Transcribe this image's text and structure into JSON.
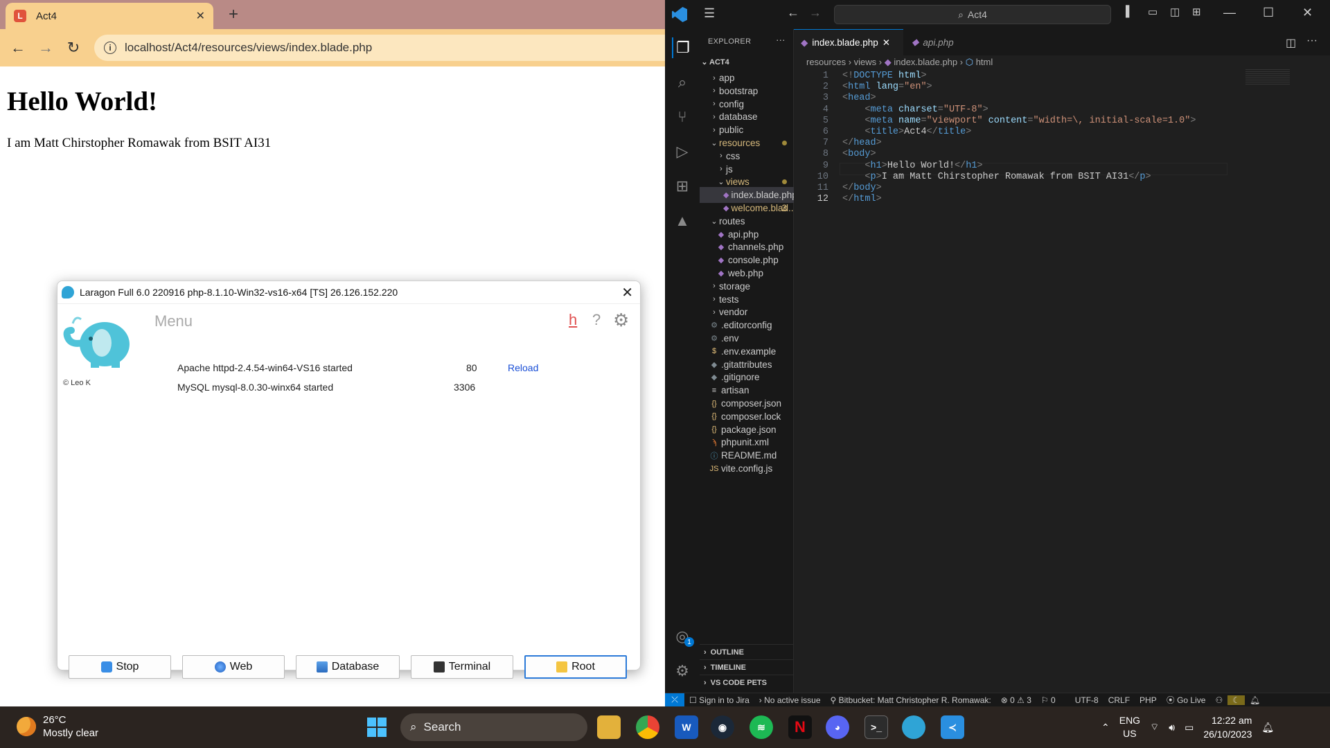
{
  "browser": {
    "tab_title": "Act4",
    "tab_close": "✕",
    "new_tab": "+",
    "url": "localhost/Act4/resources/views/index.blade.php",
    "page_heading": "Hello World!",
    "page_paragraph": "I am Matt Chirstopher Romawak from BSIT AI31"
  },
  "laragon": {
    "title": "Laragon Full 6.0 220916 php-8.1.10-Win32-vs16-x64 [TS]  26.126.152.220",
    "menu": "Menu",
    "copyright": "© Leo K",
    "h_link": "h",
    "help": "?",
    "services": [
      {
        "name": "Apache httpd-2.4.54-win64-VS16 started",
        "port": "80",
        "action": "Reload"
      },
      {
        "name": "MySQL mysql-8.0.30-winx64 started",
        "port": "3306"
      }
    ],
    "buttons": {
      "stop": "Stop",
      "web": "Web",
      "database": "Database",
      "terminal": "Terminal",
      "root": "Root"
    }
  },
  "vscode": {
    "search": "Act4",
    "explorer_label": "EXPLORER",
    "project": "ACT4",
    "tree": [
      {
        "label": "app",
        "type": "folder",
        "depth": 0
      },
      {
        "label": "bootstrap",
        "type": "folder",
        "depth": 0
      },
      {
        "label": "config",
        "type": "folder",
        "depth": 0
      },
      {
        "label": "database",
        "type": "folder",
        "depth": 0
      },
      {
        "label": "public",
        "type": "folder",
        "depth": 0
      },
      {
        "label": "resources",
        "type": "folder-open",
        "depth": 0,
        "modified": true
      },
      {
        "label": "css",
        "type": "folder",
        "depth": 1
      },
      {
        "label": "js",
        "type": "folder",
        "depth": 1
      },
      {
        "label": "views",
        "type": "folder-open",
        "depth": 1,
        "modified": true
      },
      {
        "label": "index.blade.php",
        "type": "php",
        "depth": 2,
        "selected": true
      },
      {
        "label": "welcome.blad...",
        "type": "php",
        "depth": 2,
        "modified": true,
        "badge": "3"
      },
      {
        "label": "routes",
        "type": "folder-open",
        "depth": 0
      },
      {
        "label": "api.php",
        "type": "php",
        "depth": 1
      },
      {
        "label": "channels.php",
        "type": "php",
        "depth": 1
      },
      {
        "label": "console.php",
        "type": "php",
        "depth": 1
      },
      {
        "label": "web.php",
        "type": "php",
        "depth": 1
      },
      {
        "label": "storage",
        "type": "folder",
        "depth": 0
      },
      {
        "label": "tests",
        "type": "folder",
        "depth": 0
      },
      {
        "label": "vendor",
        "type": "folder",
        "depth": 0
      },
      {
        "label": ".editorconfig",
        "type": "gear",
        "depth": 0
      },
      {
        "label": ".env",
        "type": "gear",
        "depth": 0
      },
      {
        "label": ".env.example",
        "type": "dollar",
        "depth": 0
      },
      {
        "label": ".gitattributes",
        "type": "git",
        "depth": 0
      },
      {
        "label": ".gitignore",
        "type": "git",
        "depth": 0
      },
      {
        "label": "artisan",
        "type": "lines",
        "depth": 0
      },
      {
        "label": "composer.json",
        "type": "json",
        "depth": 0
      },
      {
        "label": "composer.lock",
        "type": "json",
        "depth": 0
      },
      {
        "label": "package.json",
        "type": "json",
        "depth": 0
      },
      {
        "label": "phpunit.xml",
        "type": "rss",
        "depth": 0
      },
      {
        "label": "README.md",
        "type": "info",
        "depth": 0
      },
      {
        "label": "vite.config.js",
        "type": "js",
        "depth": 0
      }
    ],
    "tabs": [
      {
        "label": "index.blade.php",
        "active": true,
        "close": "✕"
      },
      {
        "label": "api.php",
        "active": false
      }
    ],
    "breadcrumb": [
      "resources",
      "views",
      "index.blade.php",
      "html"
    ],
    "code_lines": [
      [
        [
          "pu",
          "<!"
        ],
        [
          "tg",
          "DOCTYPE"
        ],
        [
          "pu",
          " "
        ],
        [
          "at",
          "html"
        ],
        [
          "pu",
          ">"
        ]
      ],
      [
        [
          "pu",
          "<"
        ],
        [
          "tg",
          "html"
        ],
        [
          "pu",
          " "
        ],
        [
          "at",
          "lang"
        ],
        [
          "pu",
          "="
        ],
        [
          "st",
          "\"en\""
        ],
        [
          "pu",
          ">"
        ]
      ],
      [
        [
          "pu",
          "<"
        ],
        [
          "tg",
          "head"
        ],
        [
          "pu",
          ">"
        ]
      ],
      [
        [
          "pu",
          "    <"
        ],
        [
          "tg",
          "meta"
        ],
        [
          "pu",
          " "
        ],
        [
          "at",
          "charset"
        ],
        [
          "pu",
          "="
        ],
        [
          "st",
          "\"UTF-8\""
        ],
        [
          "pu",
          ">"
        ]
      ],
      [
        [
          "pu",
          "    <"
        ],
        [
          "tg",
          "meta"
        ],
        [
          "pu",
          " "
        ],
        [
          "at",
          "name"
        ],
        [
          "pu",
          "="
        ],
        [
          "st",
          "\"viewport\""
        ],
        [
          "pu",
          " "
        ],
        [
          "at",
          "content"
        ],
        [
          "pu",
          "="
        ],
        [
          "st",
          "\"width=\\, initial-scale=1.0\""
        ],
        [
          "pu",
          ">"
        ]
      ],
      [
        [
          "pu",
          "    <"
        ],
        [
          "tg",
          "title"
        ],
        [
          "pu",
          ">"
        ],
        [
          "tx",
          "Act4"
        ],
        [
          "pu",
          "</"
        ],
        [
          "tg",
          "title"
        ],
        [
          "pu",
          ">"
        ]
      ],
      [
        [
          "pu",
          "</"
        ],
        [
          "tg",
          "head"
        ],
        [
          "pu",
          ">"
        ]
      ],
      [
        [
          "pu",
          "<"
        ],
        [
          "tg",
          "body"
        ],
        [
          "pu",
          ">"
        ]
      ],
      [
        [
          "pu",
          "    <"
        ],
        [
          "tg",
          "h1"
        ],
        [
          "pu",
          ">"
        ],
        [
          "tx",
          "Hello World!"
        ],
        [
          "pu",
          "</"
        ],
        [
          "tg",
          "h1"
        ],
        [
          "pu",
          ">"
        ]
      ],
      [
        [
          "pu",
          "    <"
        ],
        [
          "tg",
          "p"
        ],
        [
          "pu",
          ">"
        ],
        [
          "tx",
          "I am Matt Chirstopher Romawak from BSIT AI31"
        ],
        [
          "pu",
          "</"
        ],
        [
          "tg",
          "p"
        ],
        [
          "pu",
          ">"
        ]
      ],
      [
        [
          "pu",
          "</"
        ],
        [
          "tg",
          "body"
        ],
        [
          "pu",
          ">"
        ]
      ],
      [
        [
          "pu",
          "</"
        ],
        [
          "tg",
          "html"
        ],
        [
          "pu",
          ">"
        ]
      ]
    ],
    "panels": [
      "OUTLINE",
      "TIMELINE",
      "VS CODE PETS"
    ],
    "status": {
      "jira": "Sign in to Jira",
      "issue": "No active issue",
      "bitbucket": "Bitbucket: Matt Christopher R. Romawak:",
      "errors": "0",
      "warnings": "3",
      "ports": "0",
      "encoding": "UTF-8",
      "eol": "CRLF",
      "lang": "PHP",
      "golive": "Go Live"
    },
    "accounts_badge": "1"
  },
  "taskbar": {
    "temp": "26°C",
    "weather": "Mostly clear",
    "search": "Search",
    "lang1": "ENG",
    "lang2": "US",
    "time": "12:22 am",
    "date": "26/10/2023"
  }
}
